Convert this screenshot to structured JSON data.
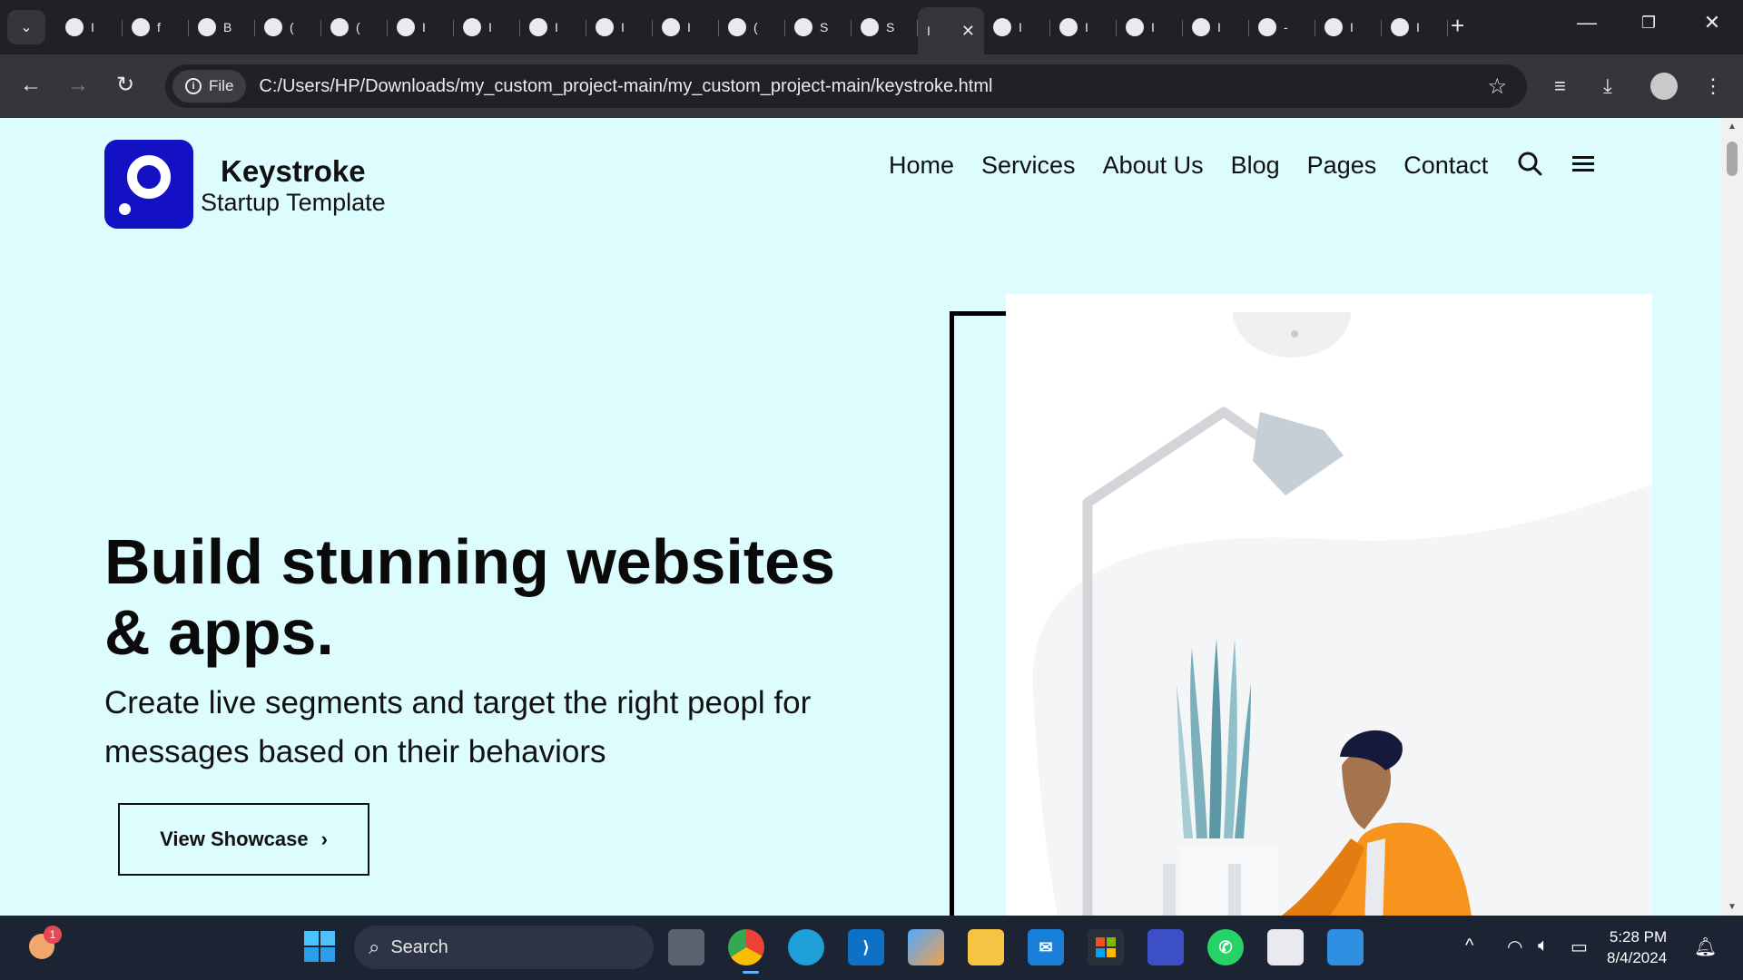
{
  "browser": {
    "tabs": [
      {
        "label": "I",
        "icon": "globe-icon"
      },
      {
        "label": "f",
        "icon": "globe-icon"
      },
      {
        "label": "B",
        "icon": "speaker-icon"
      },
      {
        "label": "(",
        "icon": "openai-icon"
      },
      {
        "label": "(",
        "icon": "github-icon"
      },
      {
        "label": "I",
        "icon": "globe-icon"
      },
      {
        "label": "I",
        "icon": "cube-icon"
      },
      {
        "label": "I",
        "icon": "chrome-icon"
      },
      {
        "label": "I",
        "icon": "globe-icon"
      },
      {
        "label": "I",
        "icon": "chrome-icon"
      },
      {
        "label": "(",
        "icon": "sparkle-icon"
      },
      {
        "label": "S",
        "icon": "globe-icon"
      },
      {
        "label": "S",
        "icon": "globe-icon"
      },
      {
        "label": "I",
        "icon": "close-icon",
        "active": true
      },
      {
        "label": "I",
        "icon": "globe-icon"
      },
      {
        "label": "I",
        "icon": "globe-icon"
      },
      {
        "label": "I",
        "icon": "globe-icon"
      },
      {
        "label": "I",
        "icon": "globe-icon"
      },
      {
        "label": "-",
        "icon": "globe-icon"
      },
      {
        "label": "I",
        "icon": "globe-icon"
      },
      {
        "label": "I",
        "icon": "globe-icon"
      }
    ],
    "address": {
      "scheme_label": "File",
      "url": "C:/Users/HP/Downloads/my_custom_project-main/my_custom_project-main/keystroke.html"
    }
  },
  "site": {
    "brand_name": "Keystroke",
    "brand_tagline": "Startup Template",
    "nav": [
      "Home",
      "Services",
      "About Us",
      "Blog",
      "Pages",
      "Contact"
    ],
    "hero_title": "Build stunning websites & apps.",
    "hero_subtitle": "Create live segments and target the right peopl for messages based on their behaviors",
    "cta_label": "View Showcase",
    "colors": {
      "page_bg": "#dcfcfe",
      "logo_bg": "#1410c4",
      "jacket": "#f7941d"
    }
  },
  "taskbar": {
    "search_placeholder": "Search",
    "notification_count": "1",
    "time": "5:28 PM",
    "date": "8/4/2024"
  }
}
